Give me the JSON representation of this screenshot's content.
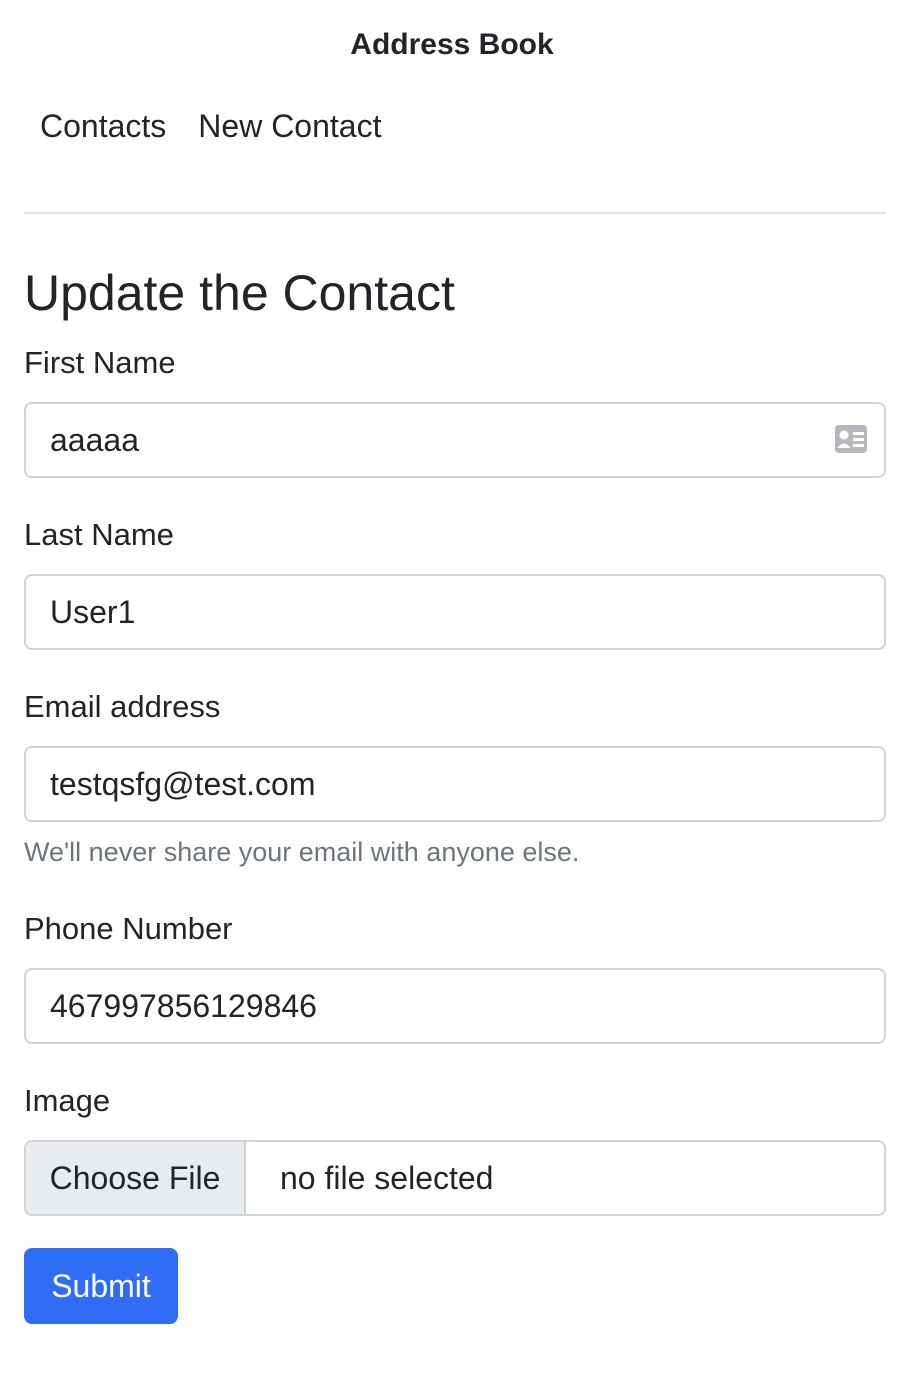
{
  "app": {
    "title": "Address Book"
  },
  "nav": {
    "items": [
      {
        "label": "Contacts"
      },
      {
        "label": "New Contact"
      }
    ]
  },
  "form": {
    "title": "Update the Contact",
    "first_name": {
      "label": "First Name",
      "value": "aaaaa"
    },
    "last_name": {
      "label": "Last Name",
      "value": "User1"
    },
    "email": {
      "label": "Email address",
      "value": "testqsfg@test.com",
      "help": "We'll never share your email with anyone else."
    },
    "phone": {
      "label": "Phone Number",
      "value": "467997856129846"
    },
    "image": {
      "label": "Image",
      "button_label": "Choose File",
      "file_status": "no file selected"
    },
    "submit_label": "Submit"
  },
  "icons": {
    "autofill": "contact-card-icon"
  },
  "colors": {
    "primary": "#2f6df6",
    "text": "#212529",
    "muted": "#6c757d",
    "border": "#ced4da"
  }
}
